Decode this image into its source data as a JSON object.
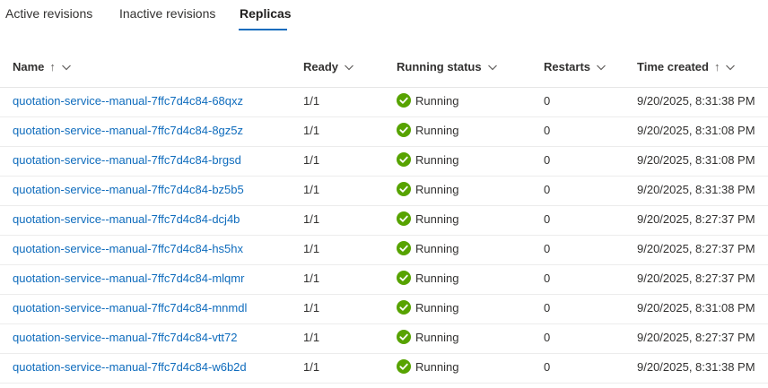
{
  "tabs": [
    {
      "label": "Active revisions"
    },
    {
      "label": "Inactive revisions"
    },
    {
      "label": "Replicas"
    }
  ],
  "columns": {
    "name": "Name",
    "ready": "Ready",
    "status": "Running status",
    "restarts": "Restarts",
    "time": "Time created"
  },
  "sort_arrow": "↑",
  "status_color": "#57a300",
  "link_color": "#0f6cbd",
  "rows": [
    {
      "name": "quotation-service--manual-7ffc7d4c84-68qxz",
      "ready": "1/1",
      "status": "Running",
      "restarts": "0",
      "time": "9/20/2025, 8:31:38 PM"
    },
    {
      "name": "quotation-service--manual-7ffc7d4c84-8gz5z",
      "ready": "1/1",
      "status": "Running",
      "restarts": "0",
      "time": "9/20/2025, 8:31:08 PM"
    },
    {
      "name": "quotation-service--manual-7ffc7d4c84-brgsd",
      "ready": "1/1",
      "status": "Running",
      "restarts": "0",
      "time": "9/20/2025, 8:31:08 PM"
    },
    {
      "name": "quotation-service--manual-7ffc7d4c84-bz5b5",
      "ready": "1/1",
      "status": "Running",
      "restarts": "0",
      "time": "9/20/2025, 8:31:38 PM"
    },
    {
      "name": "quotation-service--manual-7ffc7d4c84-dcj4b",
      "ready": "1/1",
      "status": "Running",
      "restarts": "0",
      "time": "9/20/2025, 8:27:37 PM"
    },
    {
      "name": "quotation-service--manual-7ffc7d4c84-hs5hx",
      "ready": "1/1",
      "status": "Running",
      "restarts": "0",
      "time": "9/20/2025, 8:27:37 PM"
    },
    {
      "name": "quotation-service--manual-7ffc7d4c84-mlqmr",
      "ready": "1/1",
      "status": "Running",
      "restarts": "0",
      "time": "9/20/2025, 8:27:37 PM"
    },
    {
      "name": "quotation-service--manual-7ffc7d4c84-mnmdl",
      "ready": "1/1",
      "status": "Running",
      "restarts": "0",
      "time": "9/20/2025, 8:31:08 PM"
    },
    {
      "name": "quotation-service--manual-7ffc7d4c84-vtt72",
      "ready": "1/1",
      "status": "Running",
      "restarts": "0",
      "time": "9/20/2025, 8:27:37 PM"
    },
    {
      "name": "quotation-service--manual-7ffc7d4c84-w6b2d",
      "ready": "1/1",
      "status": "Running",
      "restarts": "0",
      "time": "9/20/2025, 8:31:38 PM"
    }
  ]
}
